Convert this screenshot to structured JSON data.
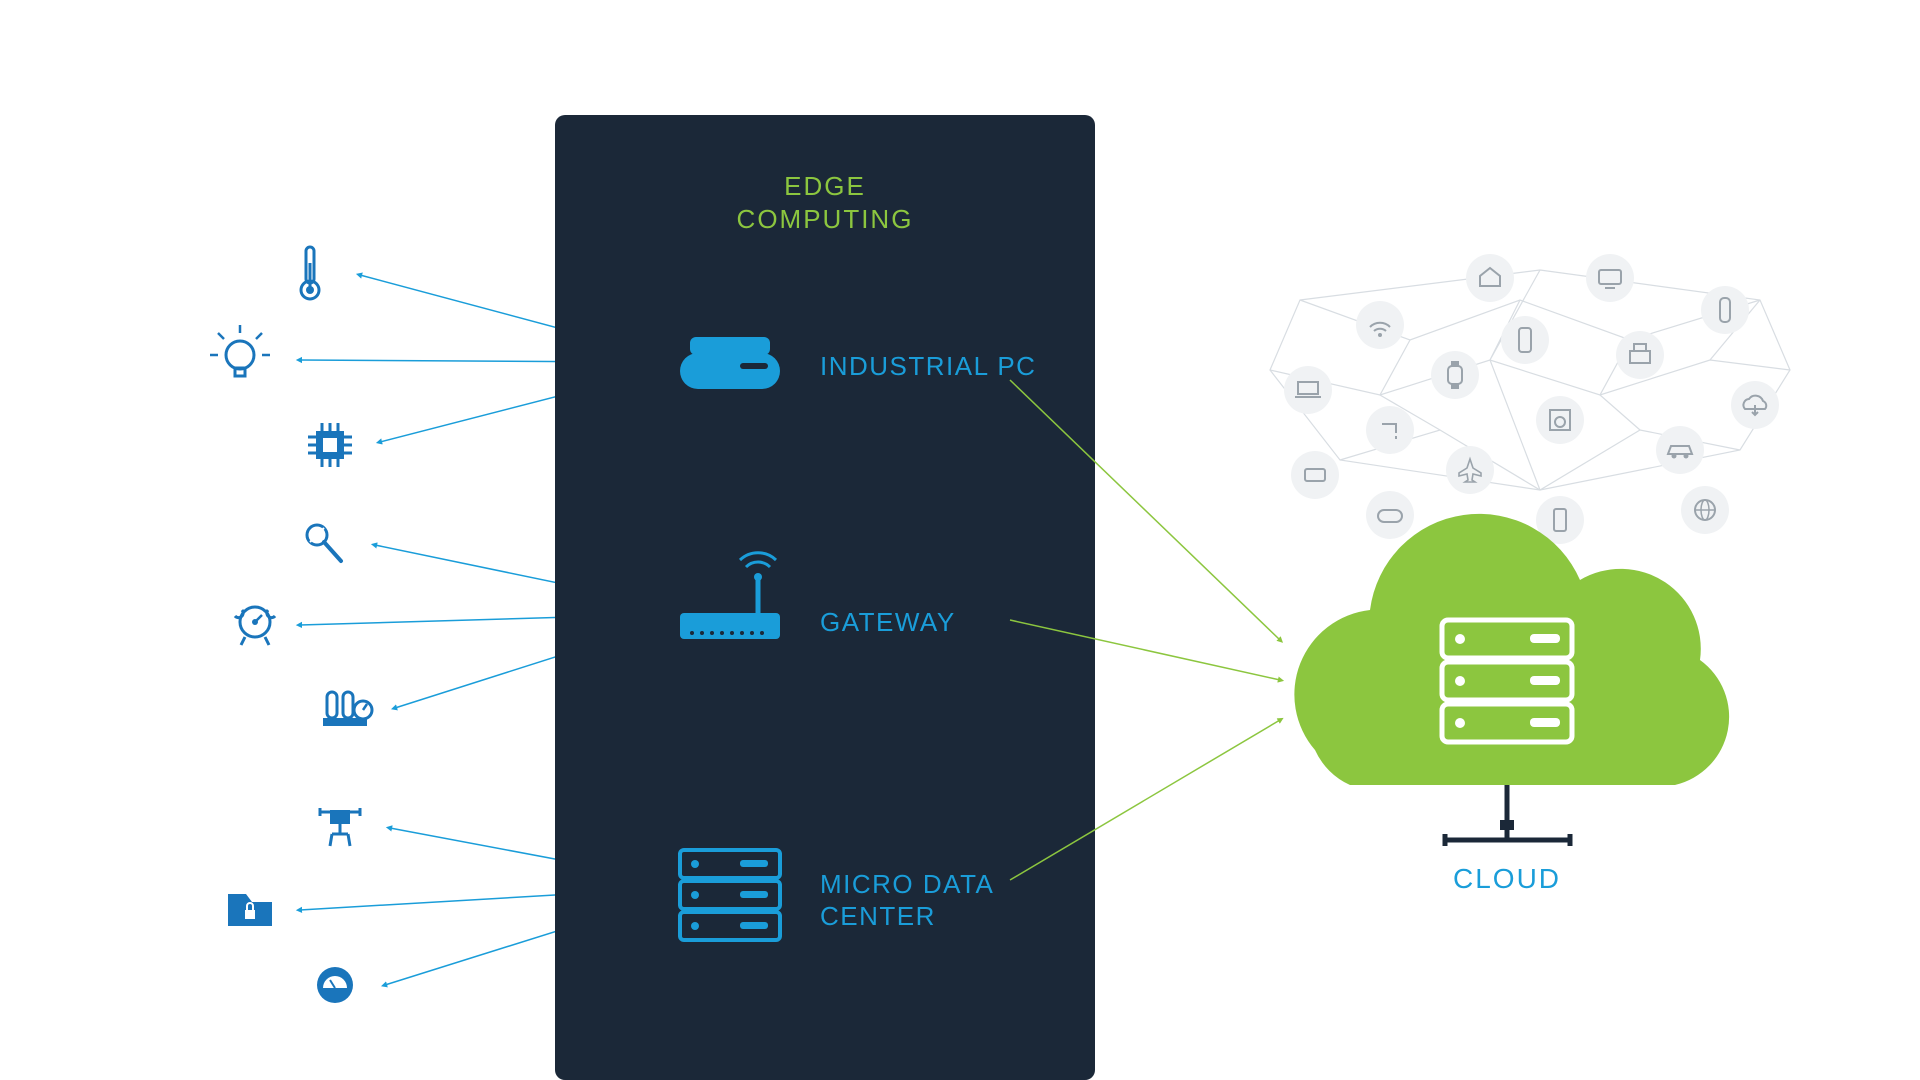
{
  "edge": {
    "title_line1": "EDGE",
    "title_line2": "COMPUTING",
    "items": [
      {
        "label": "INDUSTRIAL PC",
        "icon": "industrial-pc-icon"
      },
      {
        "label": "GATEWAY",
        "icon": "gateway-icon"
      },
      {
        "label": "MICRO DATA\nCENTER",
        "icon": "micro-data-center-icon"
      }
    ]
  },
  "cloud": {
    "label": "CLOUD"
  },
  "sensors": [
    "thermometer-icon",
    "lightbulb-icon",
    "chip-icon",
    "microphone-icon",
    "gauge-icon",
    "controls-icon",
    "robot-arm-icon",
    "secure-folder-icon",
    "meter-icon"
  ],
  "iot_nodes": [
    "monitor-icon",
    "home-icon",
    "remote-icon",
    "wifi-icon",
    "phone-icon",
    "printer-icon",
    "smartwatch-icon",
    "laptop-icon",
    "faucet-icon",
    "washer-icon",
    "cloud-download-icon",
    "shopping-icon",
    "airplane-icon",
    "car-icon",
    "gamepad-icon",
    "tablet-icon",
    "globe-icon"
  ],
  "colors": {
    "dark_panel": "#1b2838",
    "blue": "#1a9dd9",
    "deep_blue": "#0d5f9e",
    "icon_blue": "#1a75bb",
    "green": "#8cc63f",
    "lime": "#a1d03b",
    "light_grey": "#d8dde2",
    "node_grey": "#c0c6cc",
    "node_fill": "#f0f2f4"
  }
}
